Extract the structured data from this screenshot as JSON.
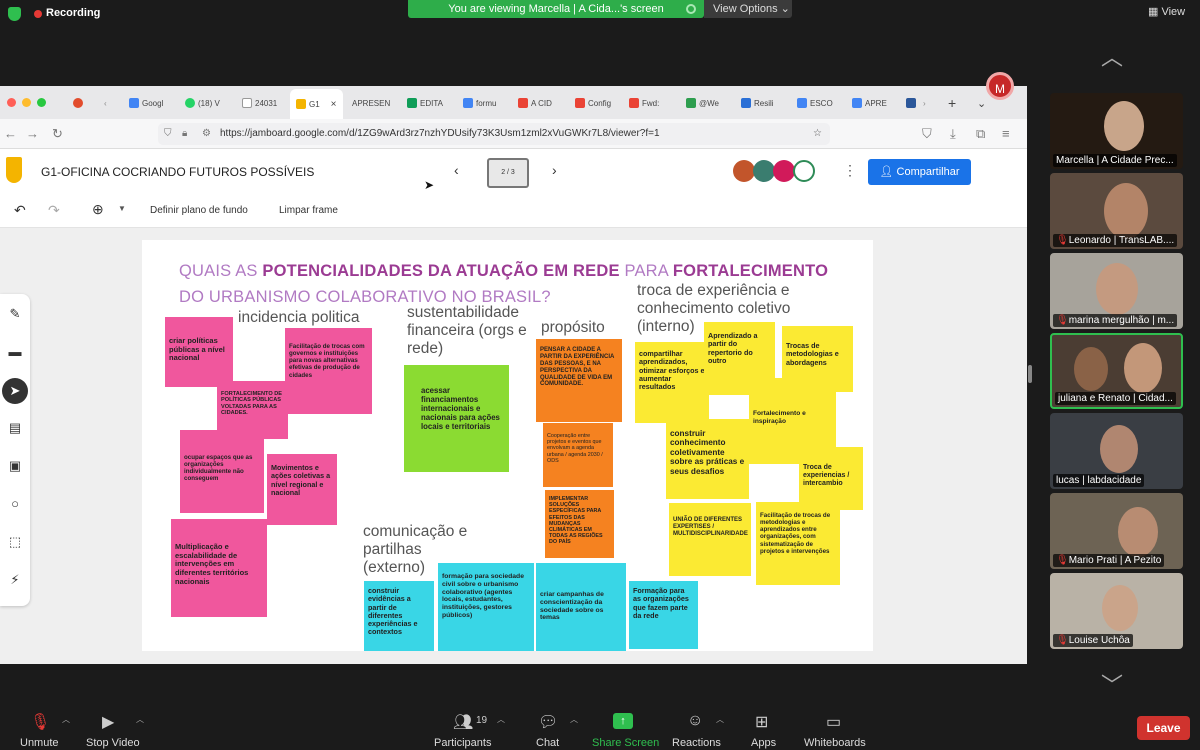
{
  "top": {
    "recording": "Recording",
    "viewing": "You are viewing Marcella | A Cida...'s screen",
    "view_options": "View Options",
    "view": "View"
  },
  "browser": {
    "tabs": [
      "Googl",
      "(18) V",
      "24031",
      "G1",
      "APRESEN",
      "EDITA",
      "formu",
      "A CID",
      "Config",
      "Fwd:",
      "@We",
      "Resili",
      "ESCO",
      "APRE"
    ],
    "url": "https://jamboard.google.com/d/1ZG9wArd3rz7nzhYDUsify73K3Usm1zml2xVuGWKr7L8/viewer?f=1"
  },
  "jamboard": {
    "title": "G1-OFICINA COCRIANDO FUTUROS POSSÍVEIS",
    "frame_counter": "2 / 3",
    "share": "Compartilhar",
    "avatar": "M",
    "set_background": "Definir plano de fundo",
    "clear_frame": "Limpar frame"
  },
  "board": {
    "question_line1_a": "QUAIS AS ",
    "question_line1_b": "POTENCIALIDADES DA ATUAÇÃO EM REDE",
    "question_line1_c": " PARA ",
    "question_line1_d": "FORTALECIMENTO",
    "question_line2": "DO URBANISMO COLABORATIVO NO BRASIL?",
    "heading_incidencia": "incidencia politica",
    "heading_sustentabilidade": "sustentabilidade financeira (orgs e rede)",
    "heading_proposito": "propósito",
    "heading_troca": "troca de experiência e conhecimento coletivo (interno)",
    "heading_comunicacao": "comunicação e partilhas (externo)",
    "notes": {
      "criar_politicas": "criar políticas públicas a nível nacional",
      "facilitacao_trocas": "Facilitação de trocas com governos e instituições para novas alternativas efetivas de produção de cidades",
      "fortalecimento_politicas": "FORTALECIMENTO DE POLÍTICAS PÚBLICAS VOLTADAS PARA AS CIDADES.",
      "ocupar_espacos": "ocupar espaços que as organizações individualmente não conseguem",
      "movimentos": "Movimentos e ações coletivas a nível regional e nacional",
      "multiplicacao": "Multiplicação e escalabilidade de intervenções em diferentes territórios nacionais",
      "acessar": "acessar financiamentos internacionais e nacionais para ações locais e territoriais",
      "pensar_cidade": "PENSAR A CIDADE A PARTIR DA EXPERIÊNCIA DAS PESSOAS, E NA PERSPECTIVA DA QUALIDADE DE VIDA EM COMUNIDADE.",
      "cooperacao": "Cooperação entre projetos e eventos que envolvam a agenda urbana / agenda 2030 / ODS",
      "implementar": "IMPLEMENTAR SOLUÇÕES ESPECÍFICAS PARA EFEITOS DAS MUDANÇAS CLIMÁTICAS EM TODAS AS REGIÕES DO PAÍS",
      "compartilhar": "compartilhar aprendizados, otimizar esforços e aumentar resultados",
      "aprendizado": "Aprendizado a partir do repertorio do outro",
      "trocas_metodologias": "Trocas de metodologias e abordagens",
      "fortalecimento_inspiracao": "Fortalecimento e inspiração",
      "construir_conhecimento": "construir conhecimento coletivamente sobre as práticas e seus desafios",
      "troca_experiencias": "Troca de experiencias / intercambio",
      "uniao": "UNIÃO DE DIFERENTES EXPERTISES / MULTIDISCIPLINARIDADE",
      "facilitacao_metodologias": "Facilitação de trocas de metodologias e aprendizados entre organizações, com sistematização de projetos e intervenções",
      "construir_evidencias": "construir evidências a partir de diferentes experiências e contextos",
      "formacao_sociedade": "formação para sociedade civil sobre o urbanismo colaborativo (agentes locais, estudantes, instituições, gestores públicos)",
      "campanhas": "criar campanhas de conscientização da sociedade sobre os temas",
      "formacao_organizacoes": "Formação para as organizações que fazem parte da rede"
    }
  },
  "participants": [
    "Marcella | A Cidade Prec...",
    "Leonardo | TransLAB....",
    "marina mergulhão | m...",
    "juliana e Renato | Cidad...",
    "lucas | labdacidade",
    "Mario Prati | A Pezito",
    "Louise Uchôa"
  ],
  "toolbar": {
    "unmute": "Unmute",
    "stop_video": "Stop Video",
    "participants": "Participants",
    "participants_count": "19",
    "chat": "Chat",
    "share_screen": "Share Screen",
    "reactions": "Reactions",
    "apps": "Apps",
    "whiteboards": "Whiteboards",
    "leave": "Leave"
  }
}
